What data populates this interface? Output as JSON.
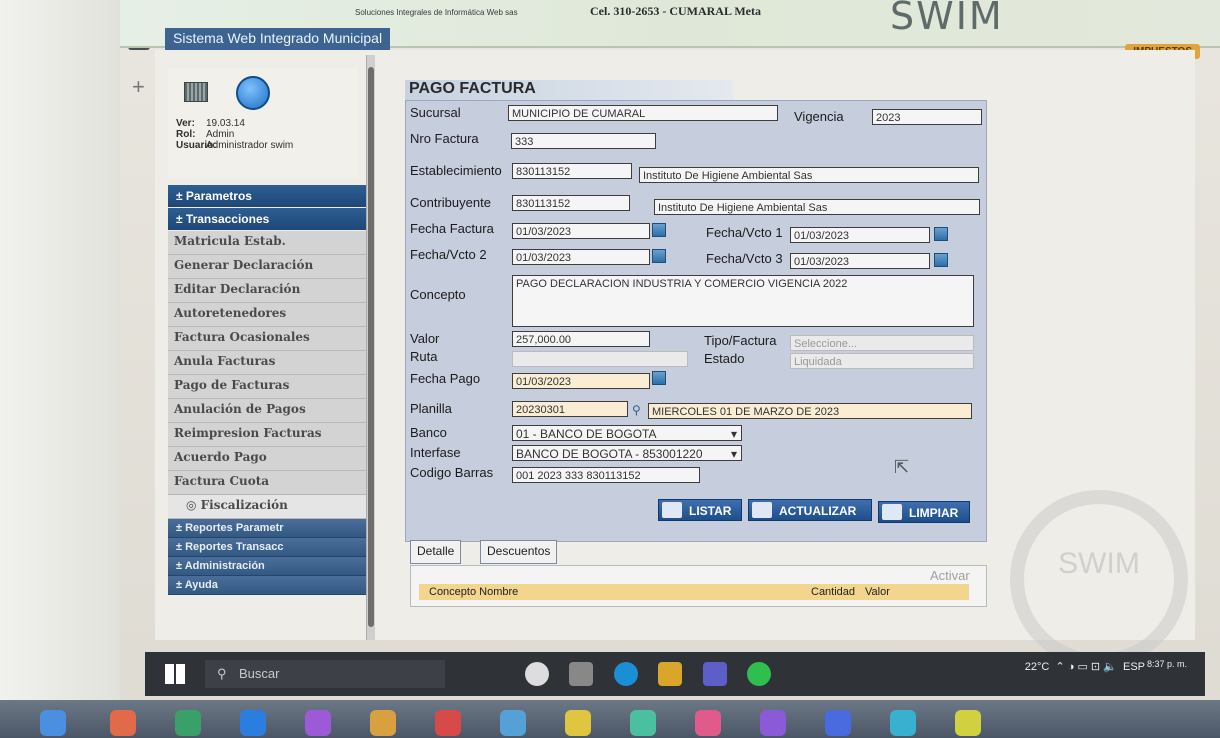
{
  "header": {
    "brand_sub": "Soluciones Integrales de Informática Web sas",
    "phone": "Cel. 310-2653  -  CUMARAL Meta",
    "logo": "SWIM",
    "system_title": "Sistema Web Integrado Municipal",
    "module_badge": "IMPUESTOS"
  },
  "user_info": {
    "ver_label": "Ver:",
    "ver": "19.03.14",
    "rol_label": "Rol:",
    "rol": "Admin",
    "usuario_label": "Usuario:",
    "usuario": "Administrador swim"
  },
  "menu": {
    "parametros": "Parametros",
    "transacciones": "Transacciones",
    "items": [
      "Matricula Estab.",
      "Generar Declaración",
      "Editar Declaración",
      "Autoretenedores",
      "Factura Ocasionales",
      "Anula Facturas",
      "Pago de Facturas",
      "Anulación de Pagos",
      "Reimpresion Facturas",
      "Acuerdo Pago",
      "Factura Cuota"
    ],
    "fiscalizacion": "Fiscalización",
    "reportes_param": "Reportes Parametr",
    "reportes_trans": "Reportes Transacc",
    "administracion": "Administración",
    "ayuda": "Ayuda"
  },
  "form": {
    "title": "PAGO FACTURA",
    "sucursal_label": "Sucursal",
    "sucursal": "MUNICIPIO DE CUMARAL",
    "vigencia_label": "Vigencia",
    "vigencia": "2023",
    "nro_factura_label": "Nro Factura",
    "nro_factura": "333",
    "establecimiento_label": "Establecimiento",
    "establecimiento_id": "830113152",
    "establecimiento_nombre": "Instituto De Higiene Ambiental Sas",
    "contribuyente_label": "Contribuyente",
    "contribuyente_id": "830113152",
    "contribuyente_nombre": "Instituto De Higiene Ambiental Sas",
    "fecha_factura_label": "Fecha Factura",
    "fecha_factura": "01/03/2023",
    "fecha_vcto1_label": "Fecha/Vcto 1",
    "fecha_vcto1": "01/03/2023",
    "fecha_vcto2_label": "Fecha/Vcto 2",
    "fecha_vcto2": "01/03/2023",
    "fecha_vcto3_label": "Fecha/Vcto 3",
    "fecha_vcto3": "01/03/2023",
    "concepto_label": "Concepto",
    "concepto": "PAGO DECLARACION INDUSTRIA Y COMERCIO VIGENCIA 2022",
    "valor_label": "Valor",
    "valor": "257,000.00",
    "tipo_factura_label": "Tipo/Factura",
    "tipo_factura": "Seleccione...",
    "ruta_label": "Ruta",
    "ruta": "",
    "estado_label": "Estado",
    "estado": "Liquidada",
    "fecha_pago_label": "Fecha Pago",
    "fecha_pago": "01/03/2023",
    "planilla_label": "Planilla",
    "planilla": "20230301",
    "planilla_desc": "MIERCOLES 01 DE MARZO DE 2023",
    "banco_label": "Banco",
    "banco": "01 - BANCO DE BOGOTA",
    "interfase_label": "Interfase",
    "interfase": "BANCO DE BOGOTA - 853001220",
    "codigo_barras_label": "Codigo Barras",
    "codigo_barras": "001 2023 333 830113152"
  },
  "buttons": {
    "listar": "LISTAR",
    "actualizar": "ACTUALIZAR",
    "limpiar": "LIMPIAR"
  },
  "tabs": {
    "detalle": "Detalle",
    "descuentos": "Descuentos"
  },
  "detail_table": {
    "concepto": "Concepto Nombre",
    "cantidad": "Cantidad",
    "valor": "Valor"
  },
  "watermark": {
    "activar": "Activar"
  },
  "taskbar": {
    "search": "Buscar",
    "temp": "22°C",
    "lang": "ESP",
    "time": "8:37 p. m."
  },
  "colors": {
    "menu_head": "#2e5e92",
    "form_bg": "#c6cedd",
    "highlight": "#fbedd4",
    "detail_head": "#f3d68d"
  }
}
